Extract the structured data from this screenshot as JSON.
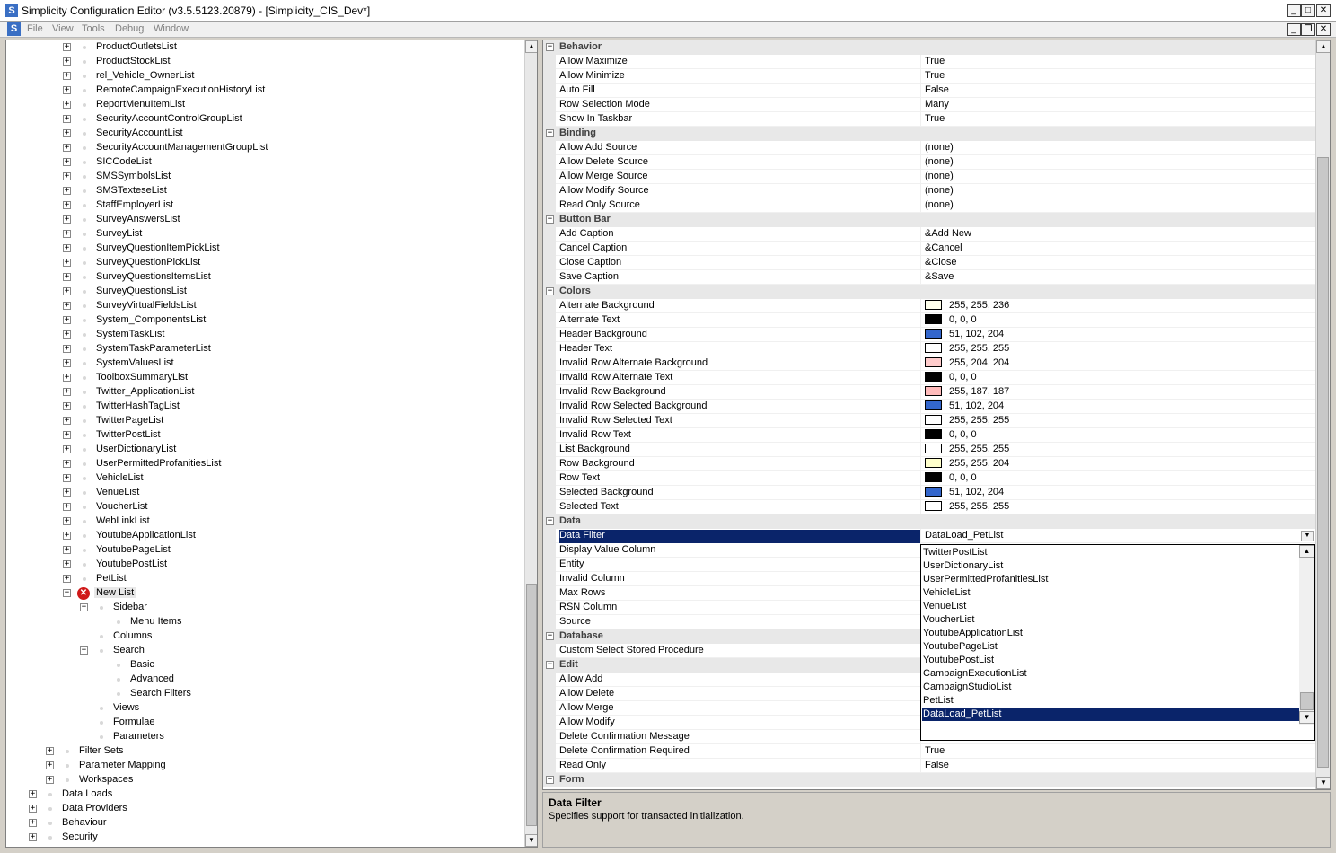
{
  "window": {
    "title": "Simplicity Configuration Editor (v3.5.5123.20879) - [Simplicity_CIS_Dev*]",
    "app_icon": "S",
    "controls": [
      "minimize-icon",
      "maximize-icon",
      "close-icon"
    ]
  },
  "menubar": {
    "items": [
      "File",
      "View",
      "Tools",
      "Debug",
      "Window"
    ]
  },
  "tree": {
    "list_items": [
      "ProductOutletsList",
      "ProductStockList",
      "rel_Vehicle_OwnerList",
      "RemoteCampaignExecutionHistoryList",
      "ReportMenuItemList",
      "SecurityAccountControlGroupList",
      "SecurityAccountList",
      "SecurityAccountManagementGroupList",
      "SICCodeList",
      "SMSSymbolsList",
      "SMSTexteseList",
      "StaffEmployerList",
      "SurveyAnswersList",
      "SurveyList",
      "SurveyQuestionItemPickList",
      "SurveyQuestionPickList",
      "SurveyQuestionsItemsList",
      "SurveyQuestionsList",
      "SurveyVirtualFieldsList",
      "System_ComponentsList",
      "SystemTaskList",
      "SystemTaskParameterList",
      "SystemValuesList",
      "ToolboxSummaryList",
      "Twitter_ApplicationList",
      "TwitterHashTagList",
      "TwitterPageList",
      "TwitterPostList",
      "UserDictionaryList",
      "UserPermittedProfanitiesList",
      "VehicleList",
      "VenueList",
      "VoucherList",
      "WebLinkList",
      "YoutubeApplicationList",
      "YoutubePageList",
      "YoutubePostList",
      "PetList"
    ],
    "new_list": "New List",
    "sidebar": "Sidebar",
    "menu_items": "Menu Items",
    "columns": "Columns",
    "search": "Search",
    "basic": "Basic",
    "advanced": "Advanced",
    "search_filters": "Search Filters",
    "views": "Views",
    "formulae": "Formulae",
    "parameters": "Parameters",
    "filter_sets": "Filter Sets",
    "parameter_mapping": "Parameter Mapping",
    "workspaces": "Workspaces",
    "data_loads": "Data Loads",
    "data_providers": "Data Providers",
    "behaviour": "Behaviour",
    "security": "Security"
  },
  "properties": {
    "behavior": {
      "title": "Behavior",
      "rows": [
        [
          "Allow Maximize",
          "True"
        ],
        [
          "Allow Minimize",
          "True"
        ],
        [
          "Auto Fill",
          "False"
        ],
        [
          "Row Selection Mode",
          "Many"
        ],
        [
          "Show In Taskbar",
          "True"
        ]
      ]
    },
    "binding": {
      "title": "Binding",
      "rows": [
        [
          "Allow Add Source",
          "(none)"
        ],
        [
          "Allow Delete Source",
          "(none)"
        ],
        [
          "Allow Merge Source",
          "(none)"
        ],
        [
          "Allow Modify Source",
          "(none)"
        ],
        [
          "Read Only Source",
          "(none)"
        ]
      ]
    },
    "button_bar": {
      "title": "Button Bar",
      "rows": [
        [
          "Add Caption",
          "&Add New"
        ],
        [
          "Cancel Caption",
          "&Cancel"
        ],
        [
          "Close Caption",
          "&Close"
        ],
        [
          "Save Caption",
          "&Save"
        ]
      ]
    },
    "colors": {
      "title": "Colors",
      "rows": [
        [
          "Alternate Background",
          "255, 255, 236",
          "#ffffec"
        ],
        [
          "Alternate Text",
          "0, 0, 0",
          "#000000"
        ],
        [
          "Header Background",
          "51, 102, 204",
          "#3366cc"
        ],
        [
          "Header Text",
          "255, 255, 255",
          "#ffffff"
        ],
        [
          "Invalid Row Alternate Background",
          "255, 204, 204",
          "#ffcccc"
        ],
        [
          "Invalid Row Alternate Text",
          "0, 0, 0",
          "#000000"
        ],
        [
          "Invalid Row Background",
          "255, 187, 187",
          "#ffbbbb"
        ],
        [
          "Invalid Row Selected Background",
          "51, 102, 204",
          "#3366cc"
        ],
        [
          "Invalid Row Selected Text",
          "255, 255, 255",
          "#ffffff"
        ],
        [
          "Invalid Row Text",
          "0, 0, 0",
          "#000000"
        ],
        [
          "List Background",
          "255, 255, 255",
          "#ffffff"
        ],
        [
          "Row Background",
          "255, 255, 204",
          "#ffffcc"
        ],
        [
          "Row Text",
          "0, 0, 0",
          "#000000"
        ],
        [
          "Selected Background",
          "51, 102, 204",
          "#3366cc"
        ],
        [
          "Selected Text",
          "255, 255, 255",
          "#ffffff"
        ]
      ]
    },
    "data": {
      "title": "Data",
      "rows": [
        [
          "Data Filter",
          "DataLoad_PetList"
        ],
        [
          "Display Value Column",
          ""
        ],
        [
          "Entity",
          ""
        ],
        [
          "Invalid Column",
          ""
        ],
        [
          "Max Rows",
          ""
        ],
        [
          "RSN Column",
          ""
        ],
        [
          "Source",
          ""
        ]
      ]
    },
    "database": {
      "title": "Database",
      "rows": [
        [
          "Custom Select Stored Procedure",
          ""
        ]
      ]
    },
    "edit": {
      "title": "Edit",
      "rows": [
        [
          "Allow Add",
          ""
        ],
        [
          "Allow Delete",
          ""
        ],
        [
          "Allow Merge",
          ""
        ],
        [
          "Allow Modify",
          ""
        ],
        [
          "Delete Confirmation Message",
          ""
        ],
        [
          "Delete Confirmation Required",
          "True"
        ],
        [
          "Read Only",
          "False"
        ]
      ]
    },
    "form": {
      "title": "Form"
    }
  },
  "dropdown": {
    "items": [
      "TwitterPostList",
      "UserDictionaryList",
      "UserPermittedProfanitiesList",
      "VehicleList",
      "VenueList",
      "VoucherList",
      "YoutubeApplicationList",
      "YoutubePageList",
      "YoutubePostList",
      "CampaignExecutionList",
      "CampaignStudioList",
      "PetList",
      "DataLoad_PetList"
    ],
    "selected": "DataLoad_PetList"
  },
  "description": {
    "title": "Data Filter",
    "text": "Specifies support for transacted initialization."
  }
}
